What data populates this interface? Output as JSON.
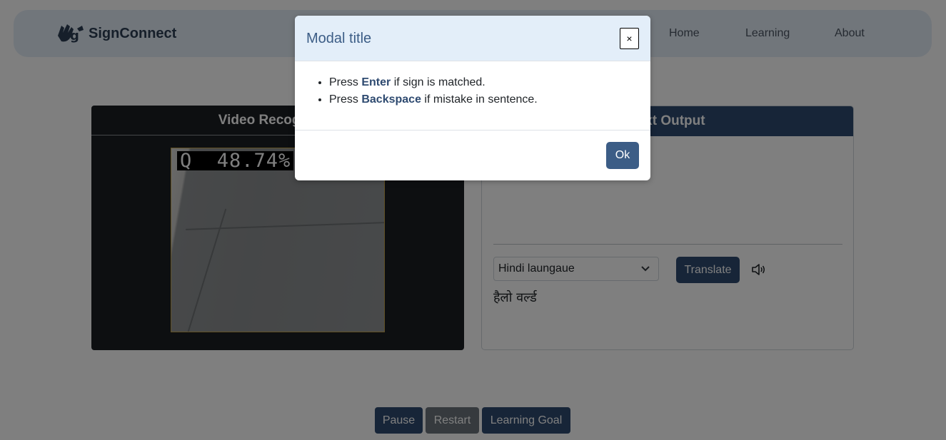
{
  "navbar": {
    "brand_name": "SignConnect",
    "links": {
      "home": "Home",
      "learning": "Learning",
      "about": "About"
    }
  },
  "video_panel": {
    "title": "Video Recognition",
    "prediction_label": "Q  48.74%"
  },
  "output_panel": {
    "title": "Text Output",
    "language_select_value": "Hindi laungaue",
    "translate_label": "Translate",
    "translated_text": "हैलो वर्ल्ड"
  },
  "controls": {
    "pause_label": "Pause",
    "restart_label": "Restart",
    "learning_goal_label": "Learning Goal"
  },
  "modal": {
    "title": "Modal title",
    "close_glyph": "×",
    "instructions": [
      {
        "prefix": "Press ",
        "key": "Enter",
        "suffix": " if sign is matched."
      },
      {
        "prefix": "Press ",
        "key": "Backspace",
        "suffix": " if mistake in sentence."
      }
    ],
    "ok_label": "Ok"
  },
  "colors": {
    "primary": "#2e4a70",
    "modal_header_bg": "#e3eef9",
    "navbar_bg": "#e3edf7",
    "secondary": "#6c757d",
    "video_bg": "#1b1e22"
  }
}
